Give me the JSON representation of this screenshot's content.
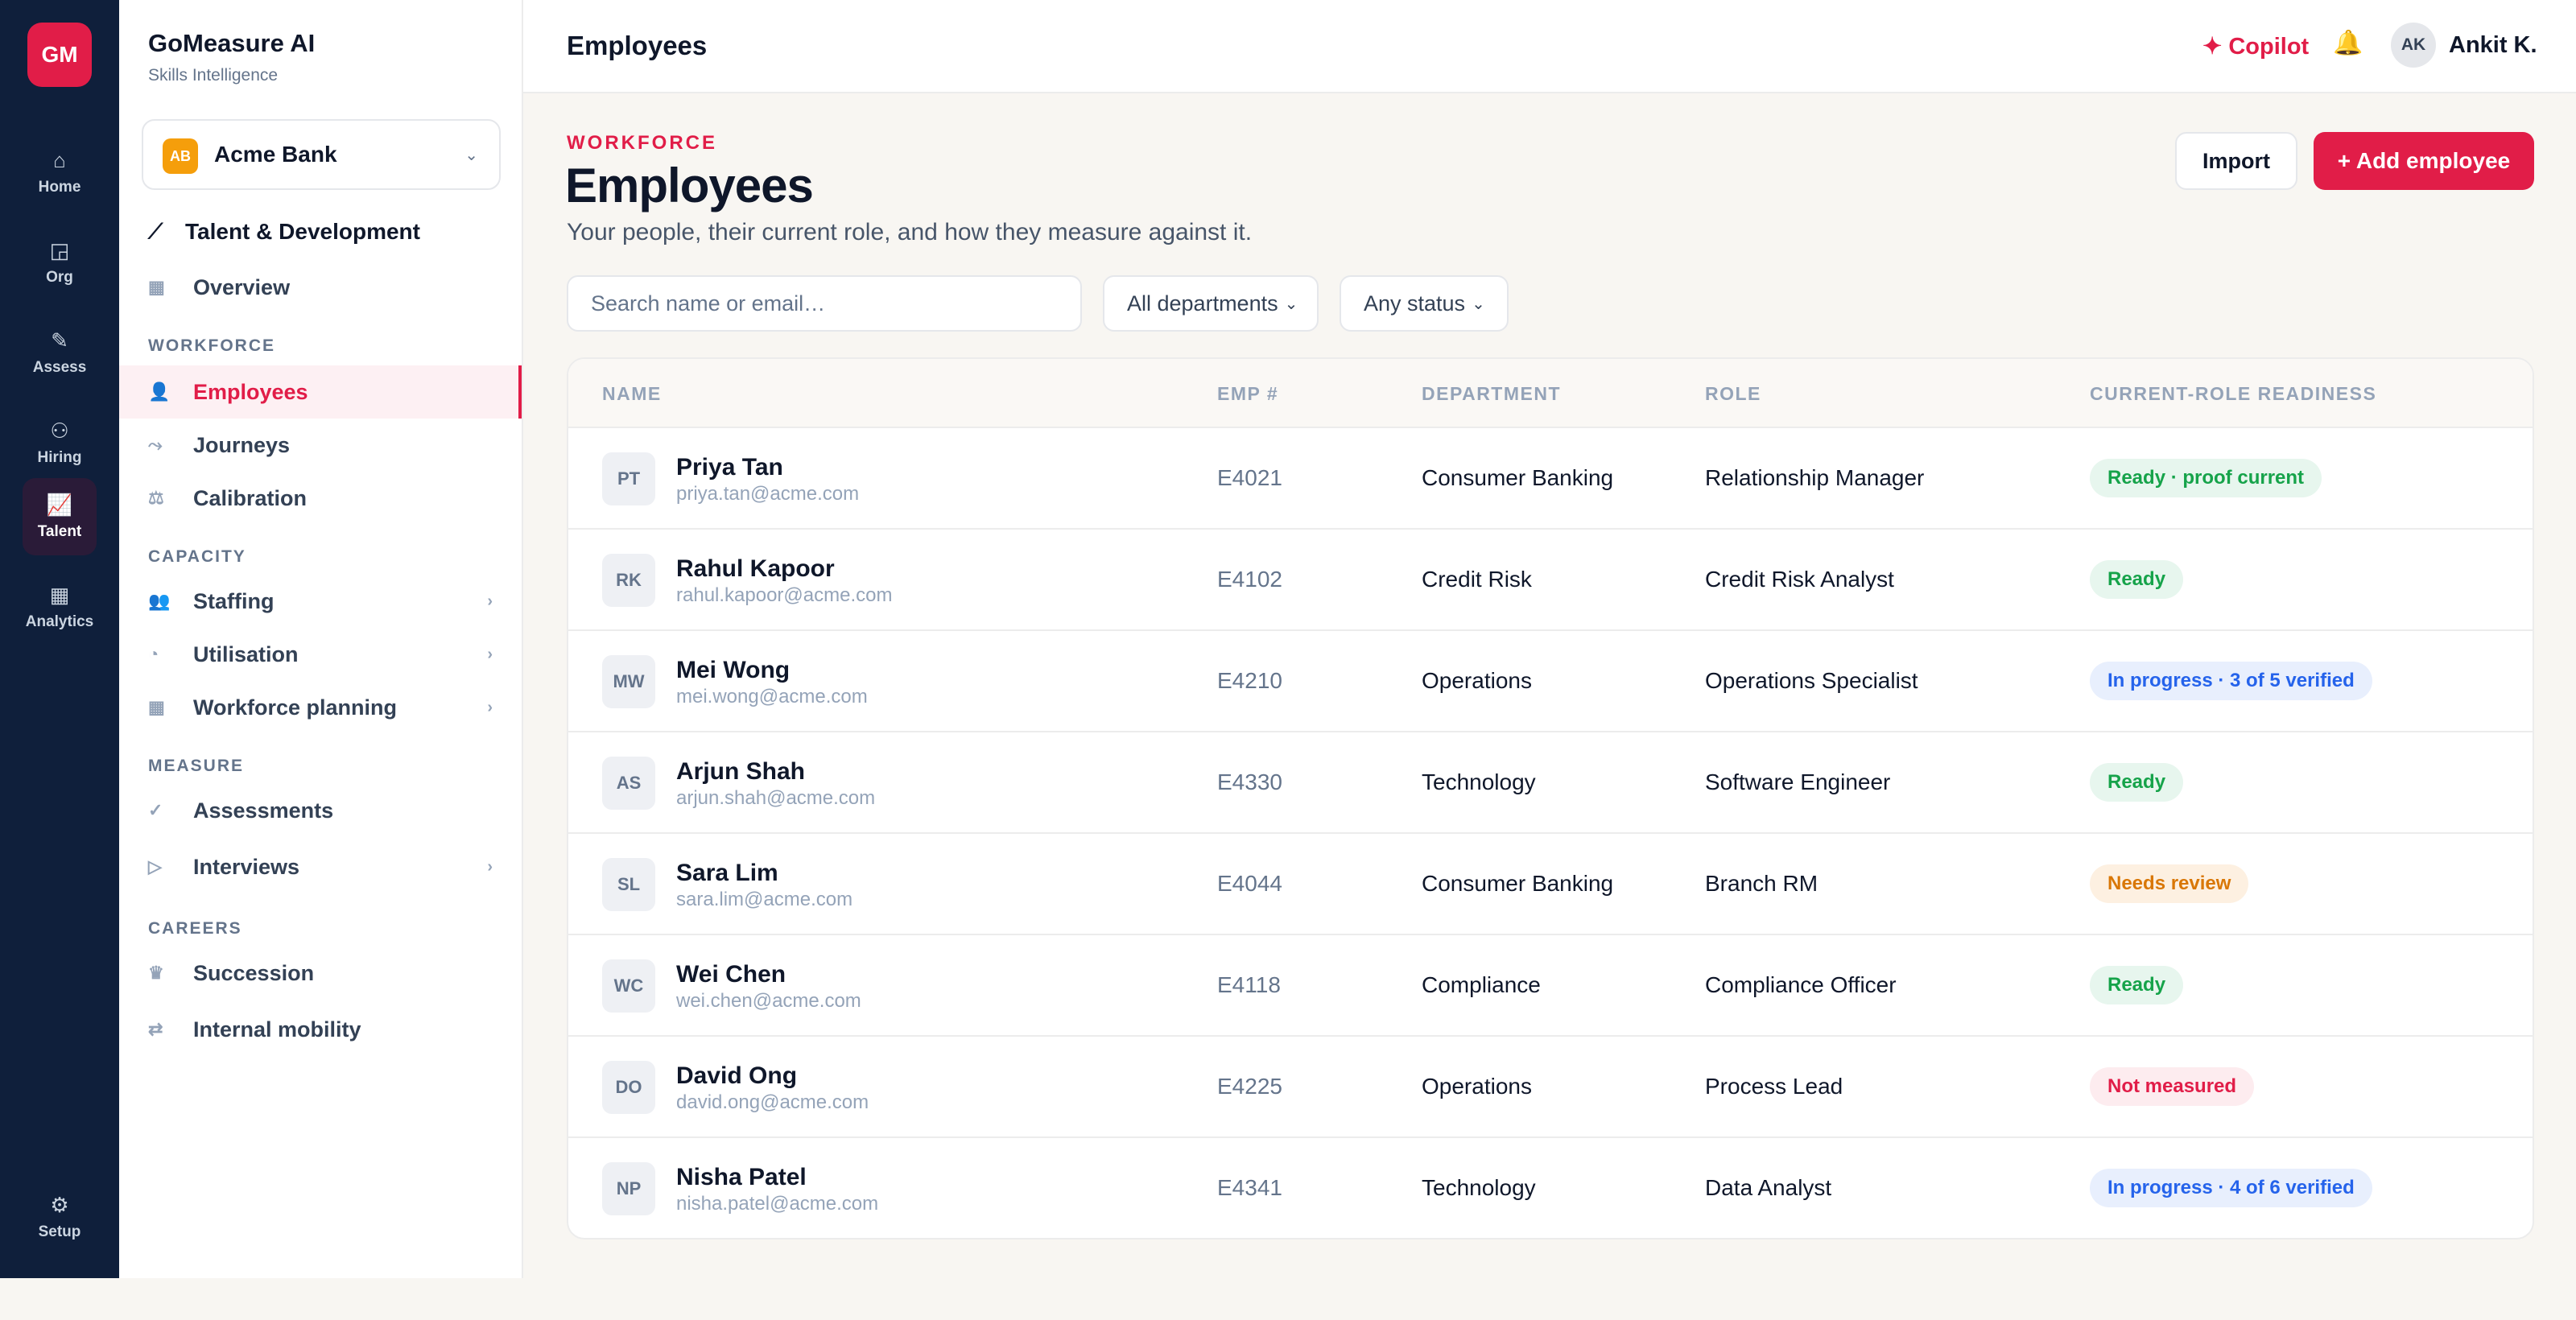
{
  "rail": {
    "logo": "GM",
    "items": [
      {
        "label": "Home",
        "icon": "⌂"
      },
      {
        "label": "Org",
        "icon": "◲"
      },
      {
        "label": "Assess",
        "icon": "✎"
      },
      {
        "label": "Hiring",
        "icon": "⚇"
      },
      {
        "label": "Talent",
        "icon": "📈"
      },
      {
        "label": "Analytics",
        "icon": "▦"
      }
    ],
    "setup": {
      "label": "Setup",
      "icon": "⚙"
    }
  },
  "sidebar": {
    "brand": "GoMeasure AI",
    "brand_sub": "Skills Intelligence",
    "org": {
      "badge": "AB",
      "name": "Acme Bank",
      "chev": "⌄"
    },
    "group_title": "Talent & Development",
    "group_icon": "⟋",
    "overview": {
      "label": "Overview",
      "icon": "▦"
    },
    "sections": {
      "workforce": "WORKFORCE",
      "capacity": "CAPACITY",
      "measure": "MEASURE",
      "careers": "CAREERS"
    },
    "items": {
      "employees": {
        "label": "Employees",
        "icon": "👤"
      },
      "journeys": {
        "label": "Journeys",
        "icon": "⤳"
      },
      "calibration": {
        "label": "Calibration",
        "icon": "⚖"
      },
      "staffing": {
        "label": "Staffing",
        "icon": "👥",
        "chev": "›"
      },
      "utilisation": {
        "label": "Utilisation",
        "icon": "◔",
        "chev": "›"
      },
      "workforce_planning": {
        "label": "Workforce planning",
        "icon": "▦",
        "chev": "›"
      },
      "assessments": {
        "label": "Assessments",
        "icon": "✓"
      },
      "interviews": {
        "label": "Interviews",
        "icon": "▷",
        "chev": "›"
      },
      "succession": {
        "label": "Succession",
        "icon": "♛"
      },
      "internal_mobility": {
        "label": "Internal mobility",
        "icon": "⇄"
      }
    }
  },
  "topbar": {
    "title": "Employees",
    "copilot": "✦ Copilot",
    "bell": "🔔",
    "user_initials": "AK",
    "user_name": "Ankit K."
  },
  "page": {
    "eyebrow": "WORKFORCE",
    "title": "Employees",
    "subtitle": "Your people, their current role, and how they measure against it.",
    "import_label": "Import",
    "add_label": "+ Add employee"
  },
  "filters": {
    "search_placeholder": "Search name or email…",
    "department": "All departments",
    "status": "Any status",
    "chev": "⌄"
  },
  "table": {
    "headers": {
      "name": "NAME",
      "emp": "EMP #",
      "department": "DEPARTMENT",
      "role": "ROLE",
      "readiness": "CURRENT-ROLE READINESS"
    },
    "rows": [
      {
        "initials": "PT",
        "name": "Priya Tan",
        "email": "priya.tan@acme.com",
        "emp": "E4021",
        "department": "Consumer Banking",
        "role": "Relationship Manager",
        "status": "Ready · proof current",
        "status_color": "#16a34a"
      },
      {
        "initials": "RK",
        "name": "Rahul Kapoor",
        "email": "rahul.kapoor@acme.com",
        "emp": "E4102",
        "department": "Credit Risk",
        "role": "Credit Risk Analyst",
        "status": "Ready",
        "status_color": "#16a34a"
      },
      {
        "initials": "MW",
        "name": "Mei Wong",
        "email": "mei.wong@acme.com",
        "emp": "E4210",
        "department": "Operations",
        "role": "Operations Specialist",
        "status": "In progress · 3 of 5 verified",
        "status_color": "#2563eb"
      },
      {
        "initials": "AS",
        "name": "Arjun Shah",
        "email": "arjun.shah@acme.com",
        "emp": "E4330",
        "department": "Technology",
        "role": "Software Engineer",
        "status": "Ready",
        "status_color": "#16a34a"
      },
      {
        "initials": "SL",
        "name": "Sara Lim",
        "email": "sara.lim@acme.com",
        "emp": "E4044",
        "department": "Consumer Banking",
        "role": "Branch RM",
        "status": "Needs review",
        "status_color": "#d97706"
      },
      {
        "initials": "WC",
        "name": "Wei Chen",
        "email": "wei.chen@acme.com",
        "emp": "E4118",
        "department": "Compliance",
        "role": "Compliance Officer",
        "status": "Ready",
        "status_color": "#16a34a"
      },
      {
        "initials": "DO",
        "name": "David Ong",
        "email": "david.ong@acme.com",
        "emp": "E4225",
        "department": "Operations",
        "role": "Process Lead",
        "status": "Not measured",
        "status_color": "#e11d48"
      },
      {
        "initials": "NP",
        "name": "Nisha Patel",
        "email": "nisha.patel@acme.com",
        "emp": "E4341",
        "department": "Technology",
        "role": "Data Analyst",
        "status": "In progress · 4 of 6 verified",
        "status_color": "#2563eb"
      }
    ]
  },
  "colors": {
    "accent": "#e11d48",
    "rail_bg": "#0f1f3b",
    "page_bg": "#f8f6f2"
  }
}
